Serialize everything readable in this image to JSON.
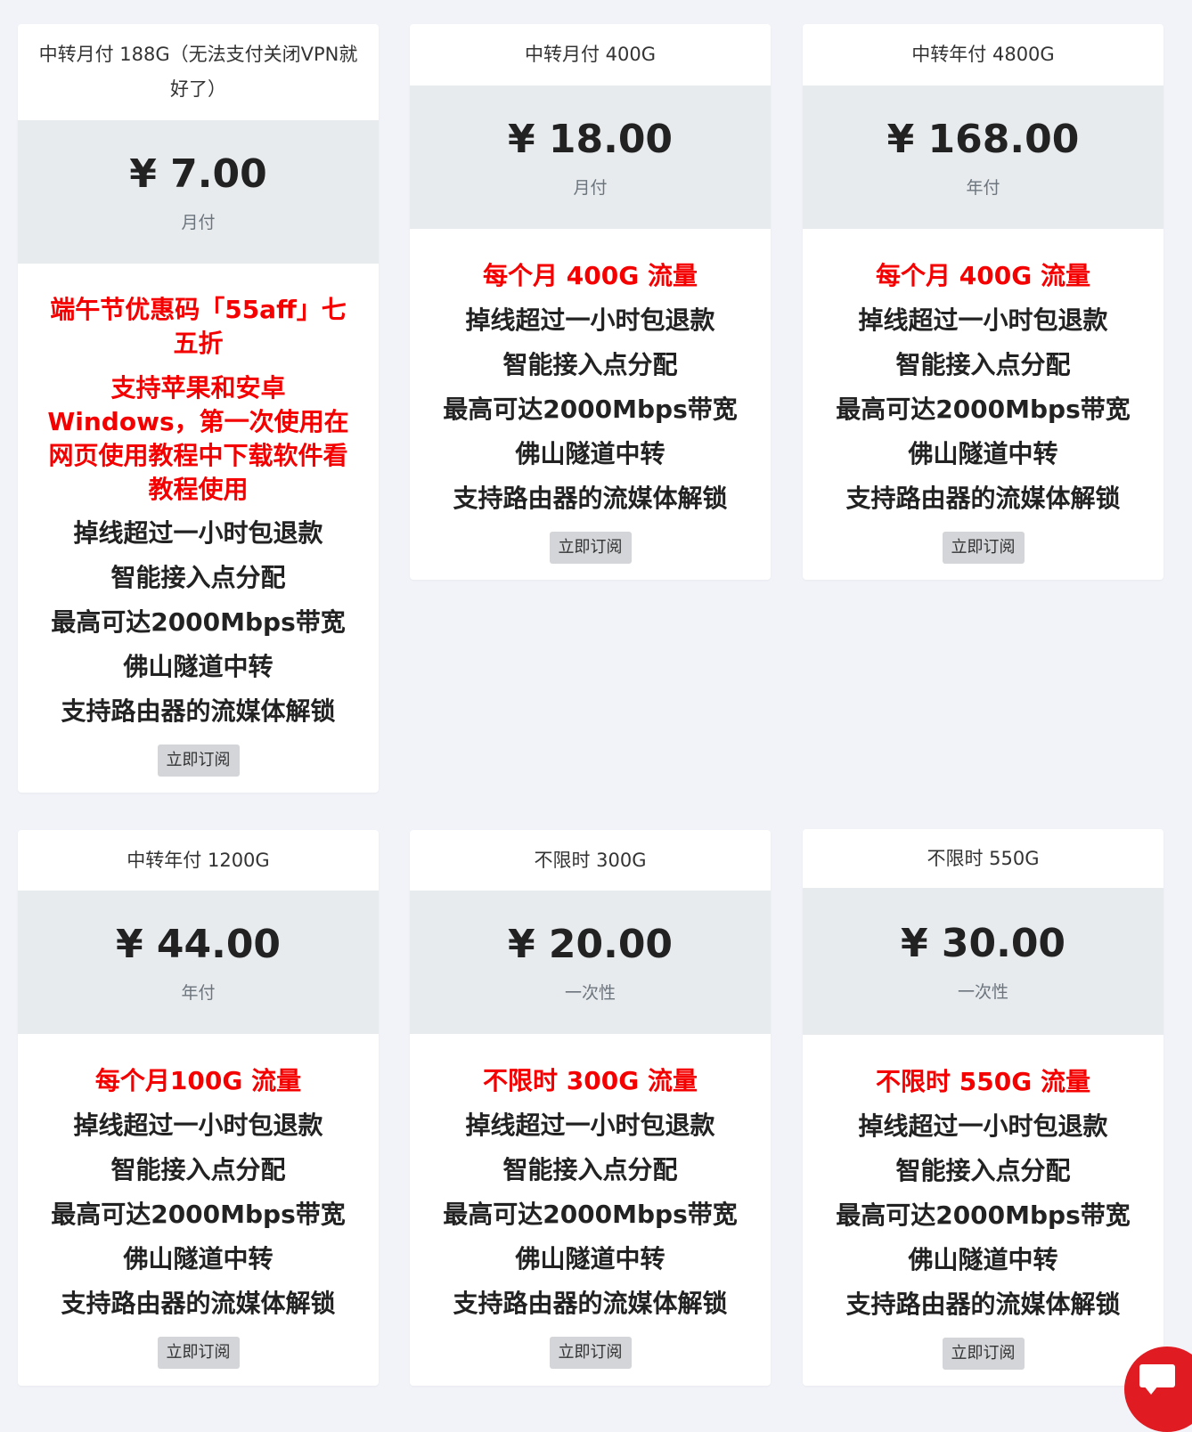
{
  "plans": [
    {
      "title": "中转月付 188G（无法支付关闭VPN就好了）",
      "price": "¥ 7.00",
      "period": "月付",
      "promo": [
        "端午节优惠码「55aff」七五折",
        "支持苹果和安卓Windows，第一次使用在网页使用教程中下载软件看教程使用"
      ],
      "features": [
        "掉线超过一小时包退款",
        "智能接入点分配",
        "最高可达2000Mbps带宽",
        "佛山隧道中转",
        "支持路由器的流媒体解锁"
      ],
      "button": "立即订阅"
    },
    {
      "title": "中转月付 400G",
      "price": "¥ 18.00",
      "period": "月付",
      "highlight": "每个月 400G 流量",
      "features": [
        "掉线超过一小时包退款",
        "智能接入点分配",
        "最高可达2000Mbps带宽",
        "佛山隧道中转",
        "支持路由器的流媒体解锁"
      ],
      "button": "立即订阅"
    },
    {
      "title": "中转年付 4800G",
      "price": "¥ 168.00",
      "period": "年付",
      "highlight": "每个月 400G 流量",
      "features": [
        "掉线超过一小时包退款",
        "智能接入点分配",
        "最高可达2000Mbps带宽",
        "佛山隧道中转",
        "支持路由器的流媒体解锁"
      ],
      "button": "立即订阅"
    },
    {
      "title": "中转年付 1200G",
      "price": "¥ 44.00",
      "period": "年付",
      "highlight": "每个月100G 流量",
      "features": [
        "掉线超过一小时包退款",
        "智能接入点分配",
        "最高可达2000Mbps带宽",
        "佛山隧道中转",
        "支持路由器的流媒体解锁"
      ],
      "button": "立即订阅"
    },
    {
      "title": "不限时 300G",
      "price": "¥ 20.00",
      "period": "一次性",
      "highlight": "不限时 300G 流量",
      "features": [
        "掉线超过一小时包退款",
        "智能接入点分配",
        "最高可达2000Mbps带宽",
        "佛山隧道中转",
        "支持路由器的流媒体解锁"
      ],
      "button": "立即订阅"
    },
    {
      "title": "不限时 550G",
      "price": "¥ 30.00",
      "period": "一次性",
      "highlight": "不限时 550G 流量",
      "features": [
        "掉线超过一小时包退款",
        "智能接入点分配",
        "最高可达2000Mbps带宽",
        "佛山隧道中转",
        "支持路由器的流媒体解锁"
      ],
      "button": "立即订阅"
    }
  ],
  "chat": {
    "icon": "chat-bubble-icon",
    "color": "#e11b22"
  }
}
